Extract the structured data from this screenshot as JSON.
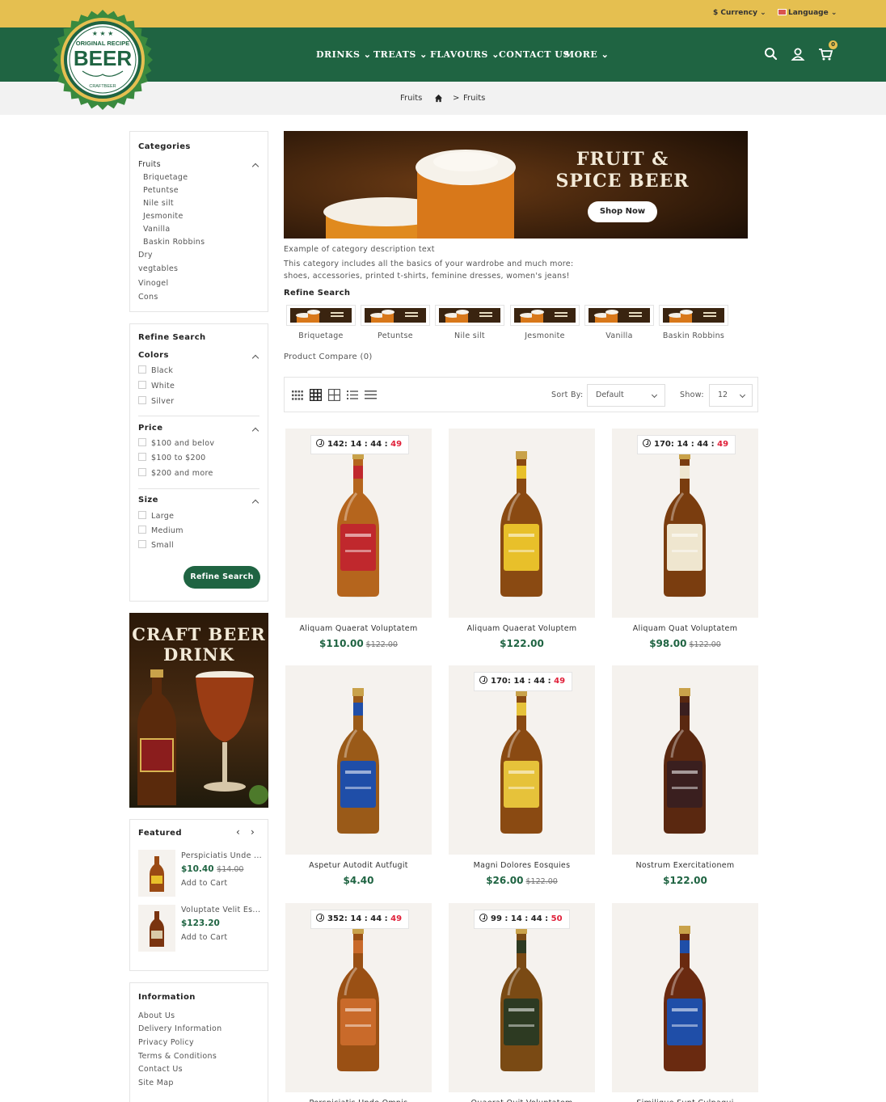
{
  "topbar": {
    "currency": "$ Currency",
    "language": "Language"
  },
  "logo": {
    "line1": "ORIGINAL RECIPE",
    "main": "BEER",
    "line3": "CRAFTBEER"
  },
  "nav": {
    "items": [
      "DRINKS",
      "TREATS",
      "FLAVOURS",
      "CONTACT US",
      "MORE"
    ],
    "cart_count": "0"
  },
  "breadcrumb": {
    "current": "Fruits",
    "trail_last": "Fruits"
  },
  "categories": {
    "title": "Categories",
    "parent": "Fruits",
    "children": [
      "Briquetage",
      "Petuntse",
      "Nile silt",
      "Jesmonite",
      "Vanilla",
      "Baskin Robbins"
    ],
    "others": [
      "Dry",
      "vegtables",
      "Vinogel",
      "Cons"
    ]
  },
  "filters": {
    "title": "Refine Search",
    "colors_title": "Colors",
    "colors": [
      "Black",
      "White",
      "Silver"
    ],
    "price_title": "Price",
    "prices": [
      "$100 and belov",
      "$100 to $200",
      "$200 and more"
    ],
    "size_title": "Size",
    "sizes": [
      "Large",
      "Medium",
      "Small"
    ],
    "button": "Refine Search"
  },
  "promo": {
    "line1": "CRAFT BEER",
    "line2": "DRINK"
  },
  "featured": {
    "title": "Featured",
    "items": [
      {
        "name": "Perspiciatis Unde ...",
        "price": "$10.40",
        "old": "$14.00",
        "cta": "Add to Cart"
      },
      {
        "name": "Voluptate Velit Es...",
        "price": "$123.20",
        "old": "",
        "cta": "Add to Cart"
      }
    ]
  },
  "information": {
    "title": "Information",
    "links": [
      "About Us",
      "Delivery Information",
      "Privacy Policy",
      "Terms & Conditions",
      "Contact Us",
      "Site Map"
    ]
  },
  "banner": {
    "title1": "FRUIT &",
    "title2": "SPICE BEER",
    "cta": "Shop Now"
  },
  "description": {
    "line1": "Example of category description text",
    "line2": "This category includes all the basics of your wardrobe and much more:",
    "line3": "shoes, accessories, printed t-shirts, feminine dresses, women's jeans!"
  },
  "refine": {
    "title": "Refine Search",
    "items": [
      "Briquetage",
      "Petuntse",
      "Nile silt",
      "Jesmonite",
      "Vanilla",
      "Baskin Robbins"
    ]
  },
  "compare": "Product Compare (0)",
  "toolbar": {
    "sort_label": "Sort By:",
    "sort_value": "Default",
    "show_label": "Show:",
    "show_value": "12"
  },
  "products": [
    {
      "name": "Aliquam Quaerat Voluptatem",
      "price": "$110.00",
      "old": "$122.00",
      "timer": "142: 14 : 44 : ",
      "timer_red": "49",
      "bottle": "#b5651d",
      "label": "#c0282d"
    },
    {
      "name": "Aliquam Quaerat Voluptem",
      "price": "$122.00",
      "old": "",
      "timer": "",
      "timer_red": "",
      "bottle": "#8a4a12",
      "label": "#e8c02a"
    },
    {
      "name": "Aliquam Quat Voluptatem",
      "price": "$98.00",
      "old": "$122.00",
      "timer": "170: 14 : 44 : ",
      "timer_red": "49",
      "bottle": "#7a3d0f",
      "label": "#efe6cf"
    },
    {
      "name": "Aspetur Autodit Autfugit",
      "price": "$4.40",
      "old": "",
      "timer": "",
      "timer_red": "",
      "bottle": "#9a5a18",
      "label": "#1f4ea8"
    },
    {
      "name": "Magni Dolores Eosquies",
      "price": "$26.00",
      "old": "$122.00",
      "timer": "170: 14 : 44 : ",
      "timer_red": "49",
      "bottle": "#8a4a12",
      "label": "#e6c23a"
    },
    {
      "name": "Nostrum Exercitationem",
      "price": "$122.00",
      "old": "",
      "timer": "",
      "timer_red": "",
      "bottle": "#5a2810",
      "label": "#3a1f1f"
    },
    {
      "name": "Perspiciatis Unde Omnis",
      "price": "",
      "old": "",
      "timer": "352: 14 : 44 : ",
      "timer_red": "49",
      "bottle": "#9a5014",
      "label": "#c96a2a"
    },
    {
      "name": "Quaerat Quit Voluptatem",
      "price": "",
      "old": "",
      "timer": "99 : 14 : 44 : ",
      "timer_red": "50",
      "bottle": "#7a4a14",
      "label": "#2d3a22"
    },
    {
      "name": "Similique Sunt Culpaqui",
      "price": "",
      "old": "",
      "timer": "",
      "timer_red": "",
      "bottle": "#6a2a10",
      "label": "#1f4ea8"
    }
  ]
}
